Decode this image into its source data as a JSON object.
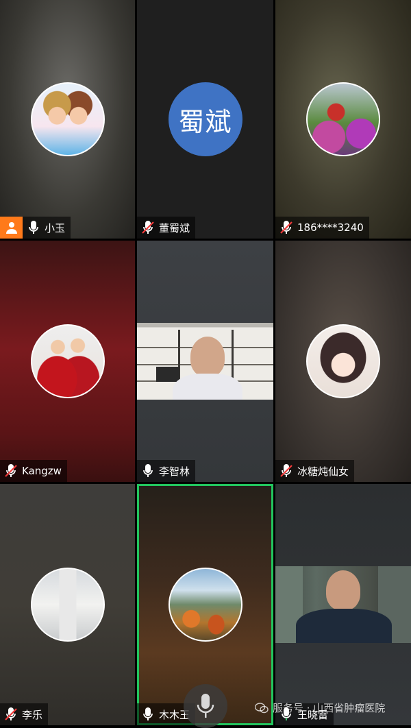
{
  "participants": [
    {
      "name": "小玉",
      "mic": "on",
      "host": true
    },
    {
      "name": "董蜀斌",
      "mic": "muted",
      "avatar_text": "蜀斌"
    },
    {
      "name": "186****3240",
      "mic": "muted"
    },
    {
      "name": "Kangzw",
      "mic": "muted"
    },
    {
      "name": "李智林",
      "mic": "on",
      "video": true
    },
    {
      "name": "冰糖炖仙女",
      "mic": "muted"
    },
    {
      "name": "李乐",
      "mic": "muted"
    },
    {
      "name": "木木王",
      "mic": "on",
      "speaking": true
    },
    {
      "name": "王晓雷",
      "mic": "on",
      "video": true
    }
  ],
  "watermark": "服务号 · 山西省肿瘤医院",
  "colors": {
    "host_badge": "#ff7a1a",
    "active_border": "#22c55e",
    "avatar_blue": "#3f73c4"
  },
  "icons": {
    "mic": "mic-icon",
    "mic_muted": "mic-muted-icon",
    "host": "person-icon",
    "bottom": "mic-icon",
    "wechat": "wechat-icon"
  }
}
